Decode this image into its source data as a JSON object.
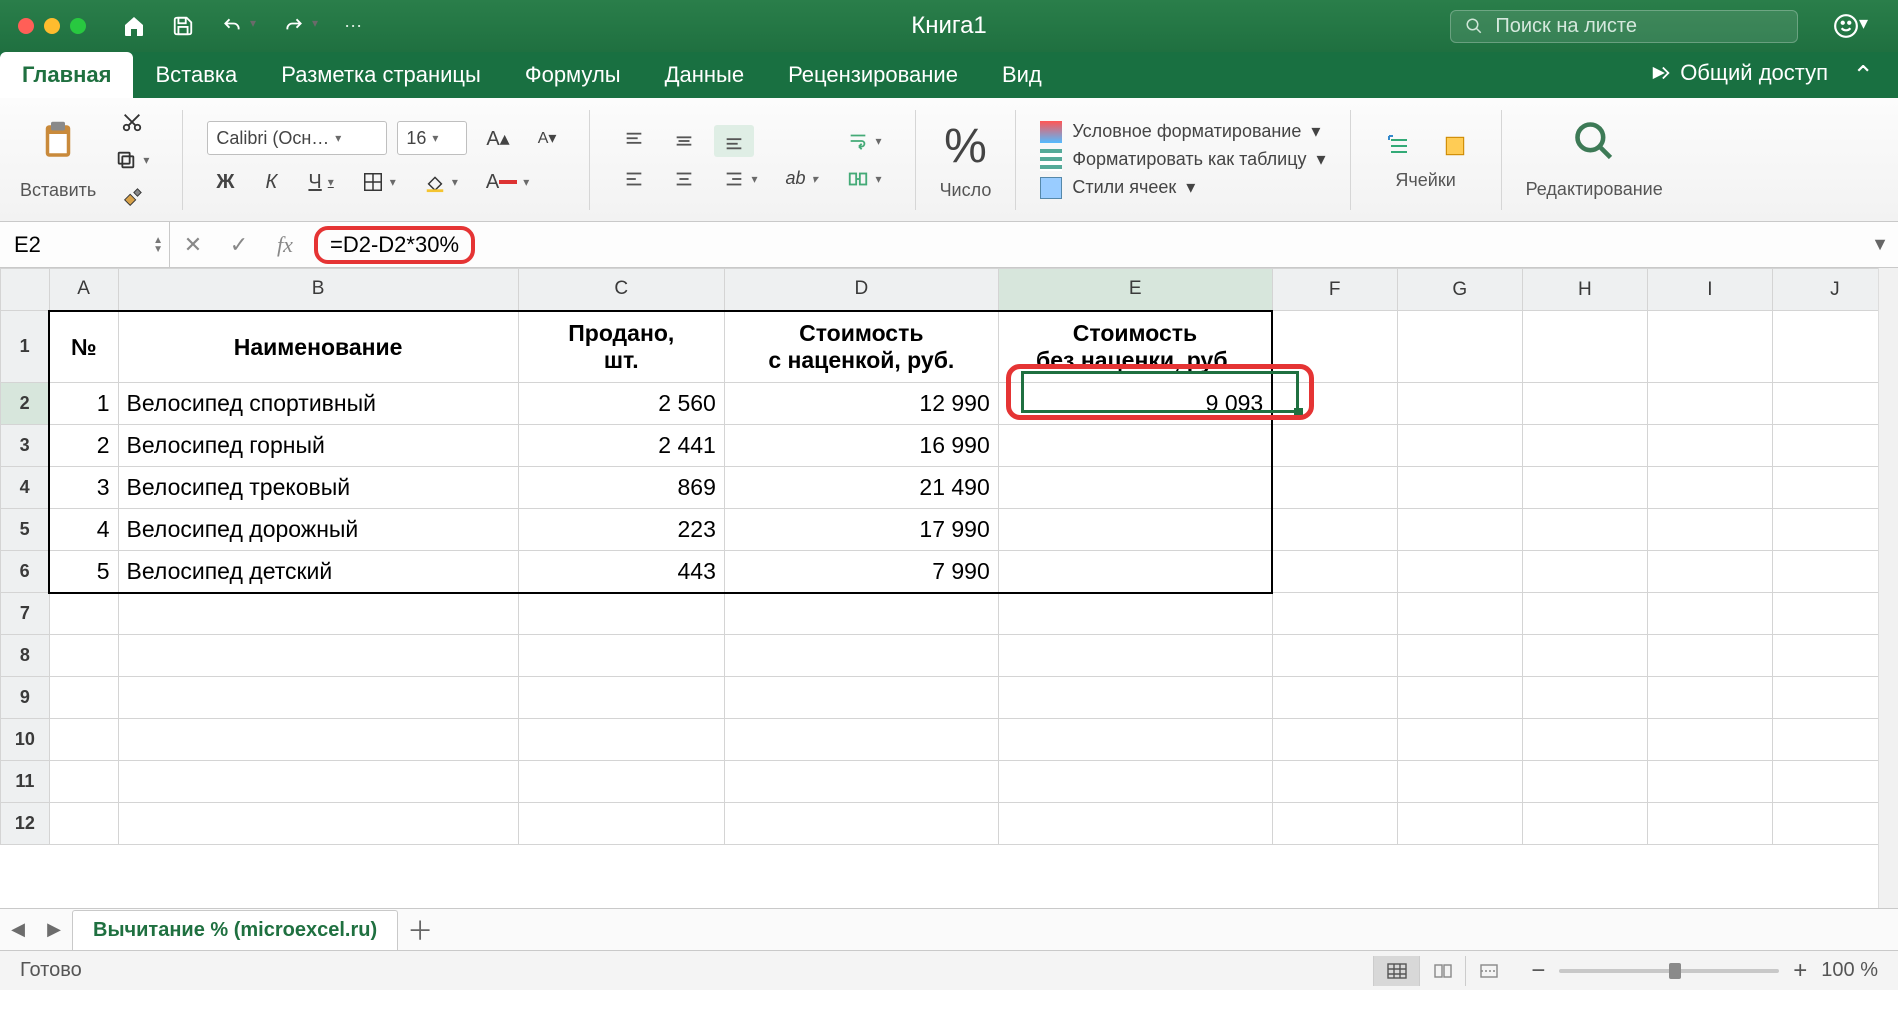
{
  "titlebar": {
    "workbook_name": "Книга1",
    "search_placeholder": "Поиск на листе"
  },
  "tabs": {
    "home": "Главная",
    "insert": "Вставка",
    "layout": "Разметка страницы",
    "formulas": "Формулы",
    "data": "Данные",
    "review": "Рецензирование",
    "view": "Вид",
    "share": "Общий доступ"
  },
  "ribbon": {
    "paste": "Вставить",
    "font_name": "Calibri (Осн…",
    "font_size": "16",
    "number": "Число",
    "cond_fmt": "Условное форматирование",
    "fmt_table": "Форматировать как таблицу",
    "cell_styles": "Стили ячеек",
    "cells": "Ячейки",
    "editing": "Редактирование"
  },
  "formula_bar": {
    "cell_ref": "E2",
    "formula": "=D2-D2*30%"
  },
  "columns": [
    "A",
    "B",
    "C",
    "D",
    "E",
    "F",
    "G",
    "H",
    "I",
    "J"
  ],
  "headers": {
    "A": "№",
    "B": "Наименование",
    "C": "Продано,\nшт.",
    "D": "Стоимость\nс наценкой, руб.",
    "E": "Стоимость\nбез наценки, руб."
  },
  "rows": [
    {
      "n": "1",
      "name": "Велосипед спортивный",
      "sold": "2 560",
      "priceM": "12 990",
      "priceN": "9 093"
    },
    {
      "n": "2",
      "name": "Велосипед горный",
      "sold": "2 441",
      "priceM": "16 990",
      "priceN": ""
    },
    {
      "n": "3",
      "name": "Велосипед трековый",
      "sold": "869",
      "priceM": "21 490",
      "priceN": ""
    },
    {
      "n": "4",
      "name": "Велосипед дорожный",
      "sold": "223",
      "priceM": "17 990",
      "priceN": ""
    },
    {
      "n": "5",
      "name": "Велосипед детский",
      "sold": "443",
      "priceM": "7 990",
      "priceN": ""
    }
  ],
  "sheet_tab": "Вычитание % (microexcel.ru)",
  "status": {
    "ready": "Готово",
    "zoom": "100 %"
  }
}
